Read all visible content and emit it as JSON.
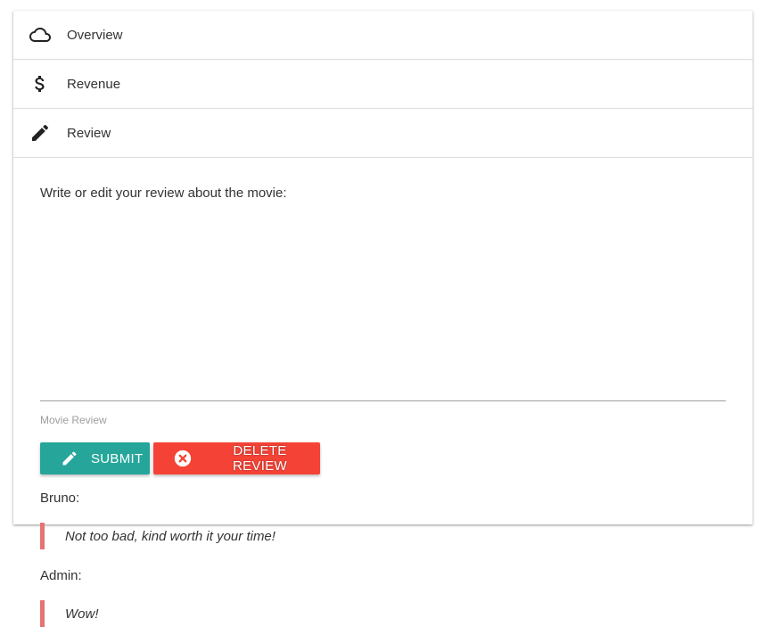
{
  "tabs": [
    {
      "label": "Overview",
      "icon": "cloud-icon"
    },
    {
      "label": "Revenue",
      "icon": "dollar-icon"
    },
    {
      "label": "Review",
      "icon": "pencil-icon"
    }
  ],
  "review_form": {
    "prompt": "Write or edit your review about the movie:",
    "input_value": "",
    "input_label": "Movie Review",
    "submit_label": "SUBMIT",
    "delete_label": "DELETE REVIEW"
  },
  "reviews": [
    {
      "author": "Bruno:",
      "text": "Not too bad, kind worth it your time!"
    },
    {
      "author": "Admin:",
      "text": "Wow!"
    }
  ],
  "colors": {
    "submit": "#26a69a",
    "delete": "#f44336",
    "quote_border": "#e57373"
  }
}
